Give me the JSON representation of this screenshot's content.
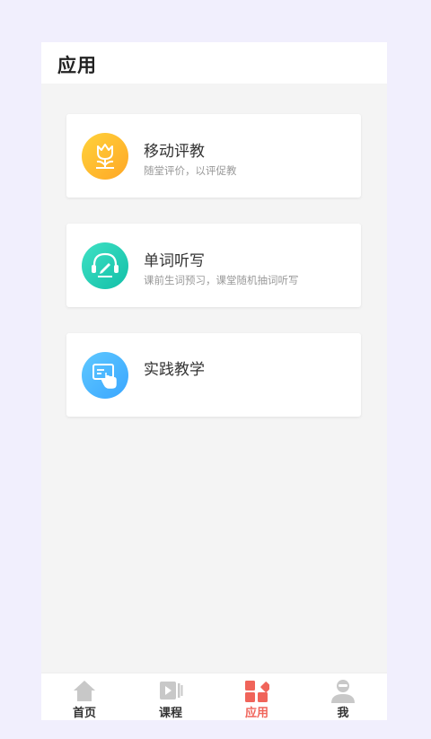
{
  "header": {
    "title": "应用"
  },
  "apps": [
    {
      "title": "移动评教",
      "subtitle": "随堂评价，以评促教",
      "icon": "tulip-icon"
    },
    {
      "title": "单词听写",
      "subtitle": "课前生词预习，课堂随机抽词听写",
      "icon": "headset-pencil-icon"
    },
    {
      "title": "实践教学",
      "subtitle": "",
      "icon": "touch-screen-icon"
    }
  ],
  "tabs": [
    {
      "label": "首页",
      "icon": "home-icon",
      "active": false
    },
    {
      "label": "课程",
      "icon": "video-course-icon",
      "active": false
    },
    {
      "label": "应用",
      "icon": "apps-grid-icon",
      "active": true
    },
    {
      "label": "我",
      "icon": "person-icon",
      "active": false
    }
  ],
  "colors": {
    "active_tab": "#f0645a",
    "inactive_icon": "#c8c8c8",
    "tulip_gradient": [
      "#ffd23a",
      "#ffa726"
    ],
    "headset_gradient": [
      "#3fe1c4",
      "#12bfa8"
    ],
    "touch_gradient": [
      "#5ec8ff",
      "#3aa6ff"
    ]
  }
}
